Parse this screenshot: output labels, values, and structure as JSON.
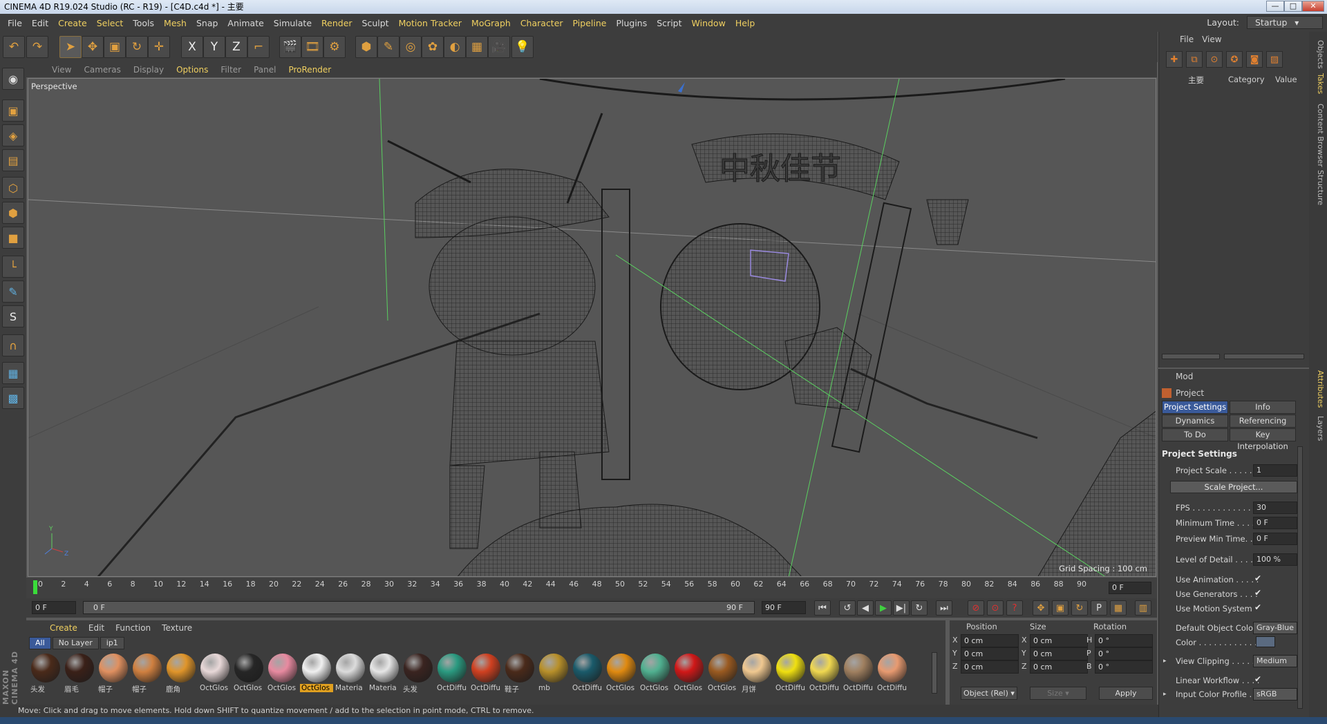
{
  "window": {
    "title": "CINEMA 4D R19.024 Studio (RC - R19) - [C4D.c4d *] - 主要",
    "minimize": "—",
    "maximize": "□",
    "close": "✕"
  },
  "menu": [
    "File",
    "Edit",
    "Create",
    "Select",
    "Tools",
    "Mesh",
    "Snap",
    "Animate",
    "Simulate",
    "Render",
    "Sculpt",
    "Motion Tracker",
    "MoGraph",
    "Character",
    "Pipeline",
    "Plugins",
    "Script",
    "Window",
    "Help"
  ],
  "layout": {
    "label": "Layout:",
    "value": "Startup"
  },
  "toolbar_icons": [
    "undo-icon",
    "redo-icon",
    "select-arrow-icon",
    "move-icon",
    "scale-icon",
    "rotate-icon",
    "move-live-icon",
    "x-axis-icon",
    "y-axis-icon",
    "z-axis-icon",
    "coordinate-system-icon",
    "render-view-icon",
    "render-picture-viewer-icon",
    "render-settings-icon",
    "cube-icon",
    "pen-icon",
    "subdivision-icon",
    "cloner-icon",
    "deformer-icon",
    "floor-icon",
    "camera-icon",
    "light-icon"
  ],
  "axis_letters": {
    "x": "X",
    "y": "Y",
    "z": "Z"
  },
  "viewport": {
    "menu": [
      "View",
      "Cameras",
      "Display",
      "Options",
      "Filter",
      "Panel",
      "ProRender"
    ],
    "label": "Perspective",
    "grid_spacing": "Grid Spacing : 100 cm",
    "sign_text": "中秋佳节"
  },
  "timeline": {
    "ticks": [
      "0",
      "2",
      "4",
      "6",
      "8",
      "10",
      "12",
      "14",
      "16",
      "18",
      "20",
      "22",
      "24",
      "26",
      "28",
      "30",
      "32",
      "34",
      "36",
      "38",
      "40",
      "42",
      "44",
      "46",
      "48",
      "50",
      "52",
      "54",
      "56",
      "58",
      "60",
      "62",
      "64",
      "66",
      "68",
      "70",
      "72",
      "74",
      "76",
      "78",
      "80",
      "82",
      "84",
      "86",
      "88",
      "90"
    ],
    "current_frame": "0 F"
  },
  "transport": {
    "start": "0 F",
    "range_start": "0 F",
    "range_end": "90 F",
    "end": "90 F"
  },
  "materials": {
    "menu": [
      "Create",
      "Edit",
      "Function",
      "Texture"
    ],
    "tabs": [
      "All",
      "No Layer",
      "ip1"
    ],
    "items": [
      {
        "name": "头发",
        "color": "#4a2a1a"
      },
      {
        "name": "眉毛",
        "color": "#3a2018"
      },
      {
        "name": "帽子",
        "color": "#e09060"
      },
      {
        "name": "帽子",
        "color": "#d08040"
      },
      {
        "name": "鹿角",
        "color": "#e0952a"
      },
      {
        "name": "OctGlos",
        "color": "#e8d8d8"
      },
      {
        "name": "OctGlos",
        "color": "#262626"
      },
      {
        "name": "OctGlos",
        "color": "#e88aa0"
      },
      {
        "name": "OctGlos",
        "color": "#f0f0f0"
      },
      {
        "name": "Materia",
        "color": "#dcdcdc"
      },
      {
        "name": "Materia",
        "color": "#e6e6e6"
      },
      {
        "name": "头发",
        "color": "#3a2420"
      },
      {
        "name": "OctDiffu",
        "color": "#2a9a80"
      },
      {
        "name": "OctDiffu",
        "color": "#d04020"
      },
      {
        "name": "鞋子",
        "color": "#4a2a1a"
      },
      {
        "name": "mb",
        "color": "#b8902a"
      },
      {
        "name": "OctDiffu",
        "color": "#1a5a6a"
      },
      {
        "name": "OctGlos",
        "color": "#e08a10"
      },
      {
        "name": "OctGlos",
        "color": "#50b090"
      },
      {
        "name": "OctGlos",
        "color": "#d01818"
      },
      {
        "name": "OctGlos",
        "color": "#9a5a20"
      },
      {
        "name": "月饼",
        "color": "#f0c890"
      },
      {
        "name": "OctDiffu",
        "color": "#f0e010"
      },
      {
        "name": "OctDiffu",
        "color": "#f0d850"
      },
      {
        "name": "OctDiffu",
        "color": "#a08060"
      },
      {
        "name": "OctDiffu",
        "color": "#e89a70"
      }
    ],
    "selected_index": 8
  },
  "coordinates": {
    "headers": [
      "Position",
      "Size",
      "Rotation"
    ],
    "rows": [
      {
        "axis": "X",
        "pos": "0 cm",
        "size_axis": "X",
        "size": "0 cm",
        "rot_axis": "H",
        "rot": "0 °"
      },
      {
        "axis": "Y",
        "pos": "0 cm",
        "size_axis": "Y",
        "size": "0 cm",
        "rot_axis": "P",
        "rot": "0 °"
      },
      {
        "axis": "Z",
        "pos": "0 cm",
        "size_axis": "Z",
        "size": "0 cm",
        "rot_axis": "B",
        "rot": "0 °"
      }
    ],
    "mode": "Object (Rel)",
    "size_mode": "Size",
    "apply": "Apply"
  },
  "status": "Move: Click and drag to move elements. Hold down SHIFT to quantize movement / add to the selection in point mode, CTRL to remove.",
  "object_panel": {
    "menu": [
      "File",
      "View"
    ],
    "col_take": "主要",
    "col_category": "Category",
    "col_value": "Value"
  },
  "attributes": {
    "menu": "Mod",
    "title": "Project",
    "tabs": [
      [
        "Project Settings",
        "Info"
      ],
      [
        "Dynamics",
        "Referencing"
      ],
      [
        "To Do",
        "Key Interpolation"
      ]
    ],
    "section": "Project Settings",
    "project_scale": {
      "label": "Project Scale . . . . . .",
      "value": "1"
    },
    "scale_btn": "Scale Project...",
    "fps": {
      "label": "FPS . . . . . . . . . . . . . .",
      "value": "30"
    },
    "min_time": {
      "label": "Minimum Time . . . . .",
      "value": "0 F"
    },
    "preview_min": {
      "label": "Preview Min Time. . .",
      "value": "0 F"
    },
    "lod": {
      "label": "Level of Detail . . . . .",
      "value": "100 %"
    },
    "use_anim": {
      "label": "Use Animation . . . . .",
      "value": "✔"
    },
    "use_gen": {
      "label": "Use Generators . . . .",
      "value": "✔"
    },
    "use_motion": {
      "label": "Use Motion System",
      "value": "✔"
    },
    "default_color": {
      "label": "Default Object Color",
      "value": "Gray-Blue"
    },
    "color": {
      "label": "Color . . . . . . . . . . . ."
    },
    "view_clipping": {
      "label": "View Clipping . . . . . .",
      "value": "Medium"
    },
    "linear_wf": {
      "label": "Linear Workflow . . . .",
      "value": "✔"
    },
    "input_profile": {
      "label": "Input Color Profile . .",
      "value": "sRGB"
    }
  },
  "side_tabs": [
    "Objects",
    "Takes",
    "Content Browser",
    "Structure",
    "Attributes",
    "Layers"
  ],
  "brand": "MAXON CINEMA 4D"
}
